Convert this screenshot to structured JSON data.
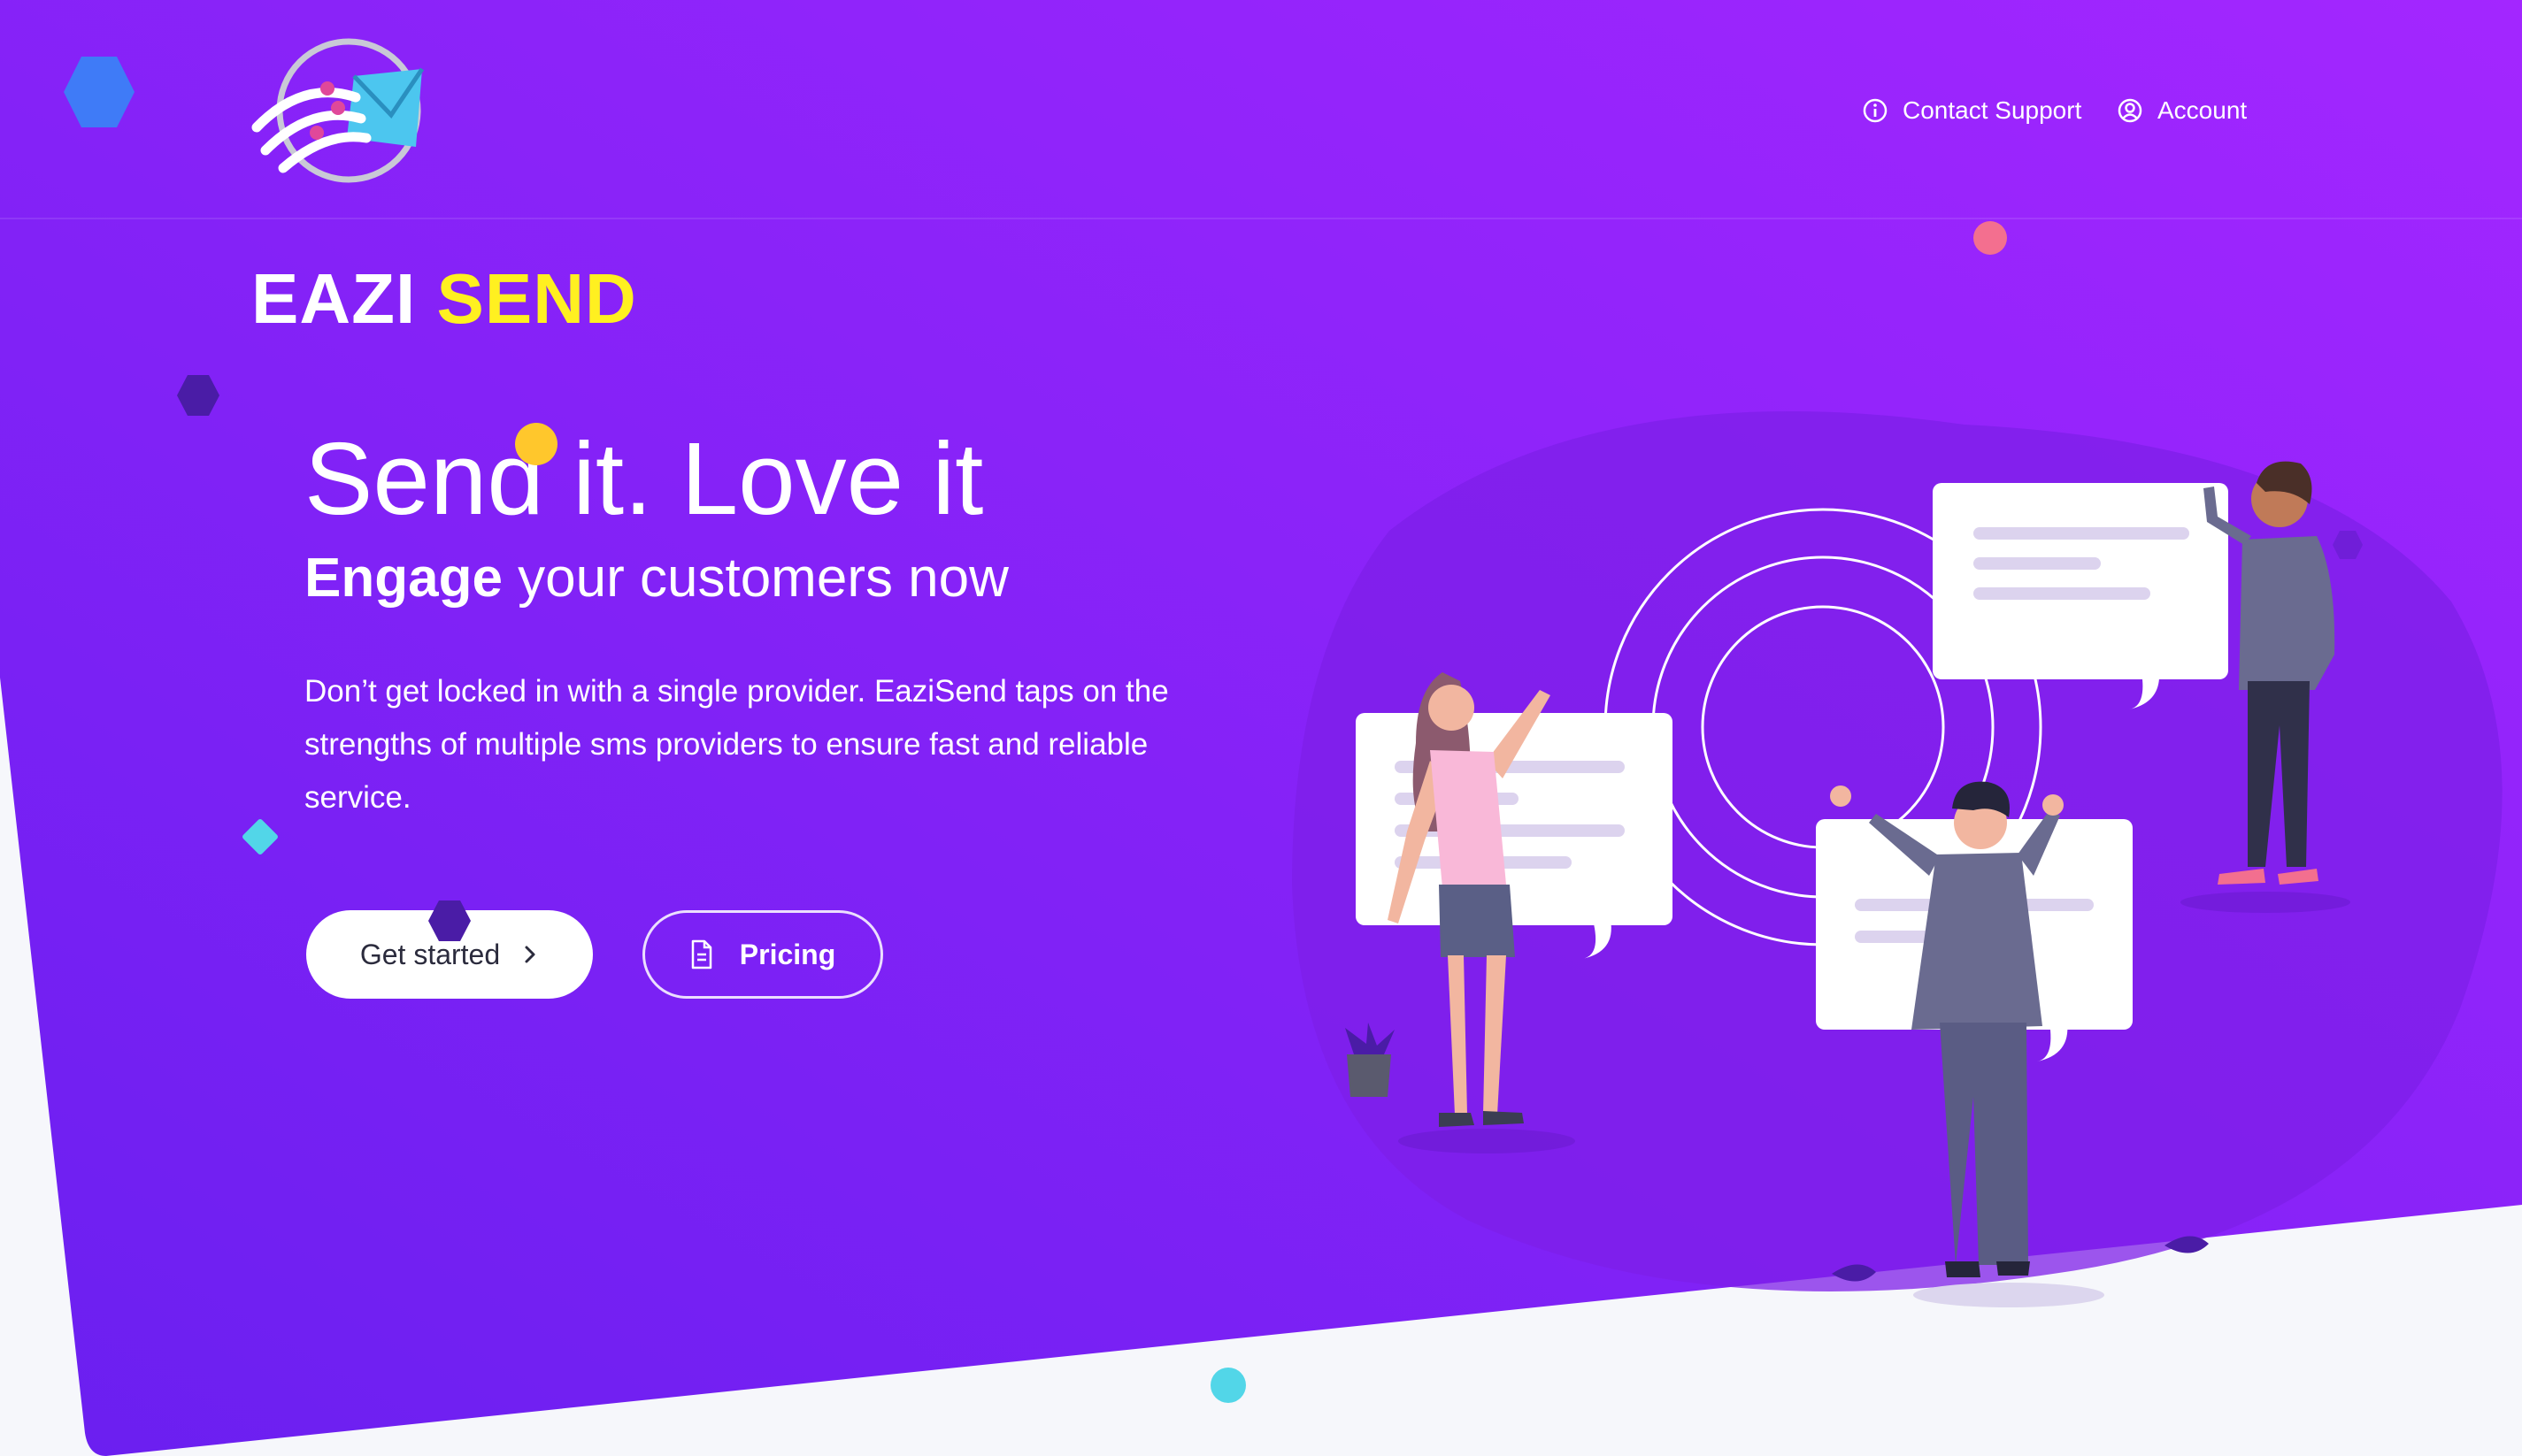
{
  "brand": {
    "part1": "EAZI",
    "part2": "SEND"
  },
  "nav": {
    "contact_support": "Contact Support",
    "account": "Account"
  },
  "hero": {
    "headline": "Send it. Love it",
    "subhead_bold": "Engage",
    "subhead_rest": " your customers now",
    "description": "Don’t get locked in with a single provider. EaziSend taps on the strengths of multiple sms providers to ensure fast and reliable service.",
    "get_started_label": "Get started",
    "pricing_label": "Pricing"
  },
  "colors": {
    "hero_gradient_start": "#7a1bf0",
    "hero_gradient_end": "#a024ff",
    "brand_accent": "#fff020",
    "page_background": "#f6f7fb"
  },
  "icons": {
    "logo": "envelope-comet-logo",
    "contact_support": "info-circle-icon",
    "account": "user-circle-icon",
    "get_started": "chevron-right-icon",
    "pricing": "document-icon"
  }
}
